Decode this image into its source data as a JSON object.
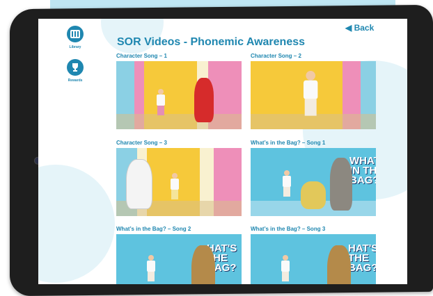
{
  "app": {
    "page_title": "SOR Videos - Phonemic Awareness",
    "back_label": "Back",
    "back_icon": "caret-left-icon"
  },
  "sidebar": {
    "items": [
      {
        "label": "Library",
        "icon": "library-icon"
      },
      {
        "label": "Rewards",
        "icon": "trophy-icon"
      }
    ]
  },
  "videos": [
    {
      "title": "Character Song – 1"
    },
    {
      "title": "Character Song – 2"
    },
    {
      "title": "Character Song – 3"
    },
    {
      "title": "What’s in the Bag? – Song 1"
    },
    {
      "title": "What’s in the Bag? – Song 2"
    },
    {
      "title": "What’s in the Bag? – Song 3"
    }
  ],
  "thumb_text": {
    "bag_1": "WHAT'S\nIN THE\nBAG?",
    "bag_2": "HAT'S\nTHE\nBAG?",
    "bag_3": "HAT'S\nTHE\nBAG?"
  },
  "colors": {
    "accent": "#1f87b0",
    "tablet_frame": "#1e1e1e",
    "thumb_yellow": "#f6c93a",
    "thumb_blue": "#5ec3df"
  }
}
